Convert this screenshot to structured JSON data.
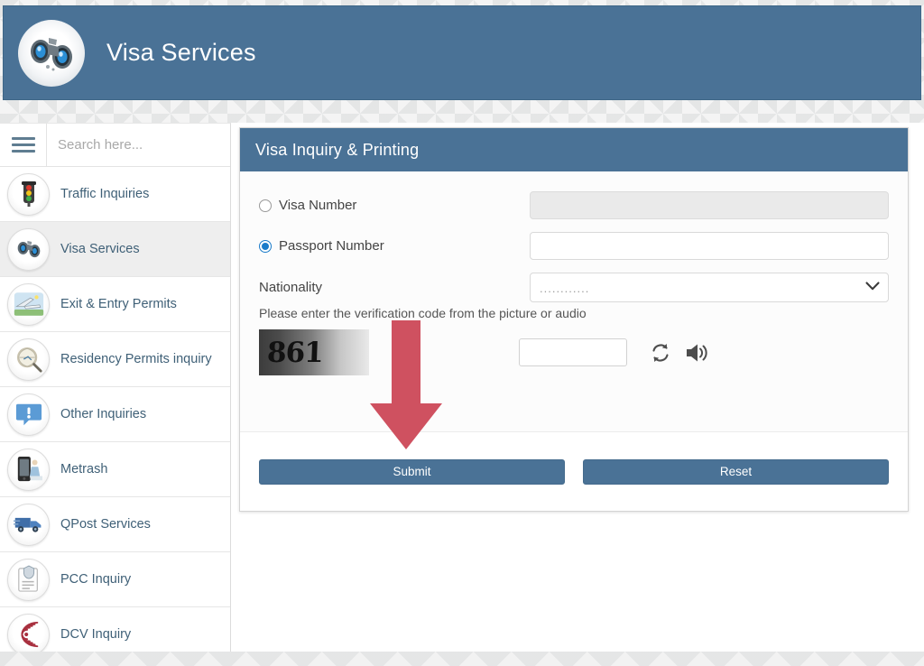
{
  "header": {
    "title": "Visa Services",
    "logo_icon": "binoculars-icon",
    "background_color": "#4a7296"
  },
  "sidebar": {
    "menu_icon": "hamburger-menu-icon",
    "search": {
      "placeholder": "Search here...",
      "value": ""
    },
    "items": [
      {
        "label": "Traffic Inquiries",
        "icon": "traffic-light-icon",
        "active": false
      },
      {
        "label": "Visa Services",
        "icon": "binoculars-icon",
        "active": true
      },
      {
        "label": "Exit & Entry Permits",
        "icon": "airplane-icon",
        "active": false
      },
      {
        "label": "Residency Permits inquiry",
        "icon": "magnifier-globe-icon",
        "active": false
      },
      {
        "label": "Other Inquiries",
        "icon": "exclamation-bubble-icon",
        "active": false
      },
      {
        "label": "Metrash",
        "icon": "mobile-phone-icon",
        "active": false
      },
      {
        "label": "QPost Services",
        "icon": "delivery-truck-icon",
        "active": false
      },
      {
        "label": "PCC Inquiry",
        "icon": "certificate-icon",
        "active": false
      },
      {
        "label": "DCV Inquiry",
        "icon": "fingerprint-icon",
        "active": false
      }
    ]
  },
  "panel": {
    "title": "Visa Inquiry & Printing",
    "header_color": "#4a7296",
    "fields": {
      "visa_number": {
        "label": "Visa Number",
        "selected": false,
        "value": "",
        "disabled": true
      },
      "passport_number": {
        "label": "Passport Number",
        "selected": true,
        "value": "",
        "disabled": false
      },
      "nationality": {
        "label": "Nationality",
        "selected_option": "............",
        "chevron_icon": "chevron-down-icon"
      }
    },
    "captcha": {
      "hint": "Please enter the verification code from the picture or audio",
      "code_text": "861",
      "input_value": "",
      "refresh_icon": "refresh-icon",
      "audio_icon": "speaker-icon"
    },
    "actions": {
      "submit_label": "Submit",
      "reset_label": "Reset",
      "button_color": "#4a7296"
    }
  },
  "annotation": {
    "arrow_icon": "down-arrow-annotation",
    "color": "#cf5160",
    "points_at": "Submit"
  }
}
